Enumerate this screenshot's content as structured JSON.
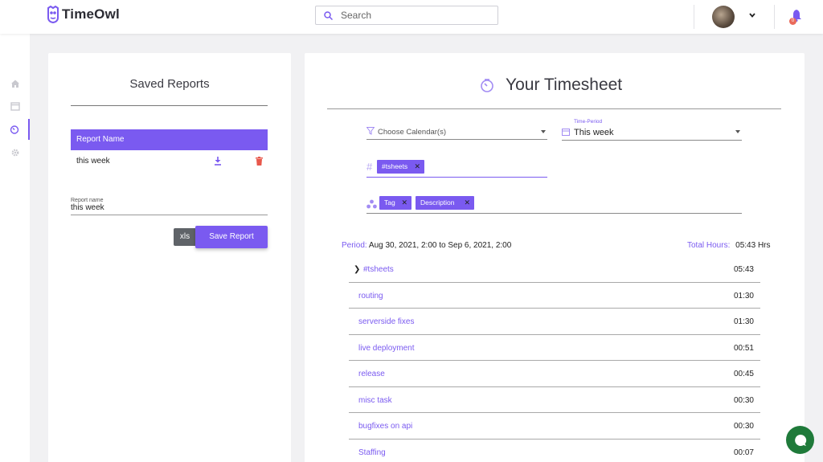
{
  "header": {
    "app_name": "TimeOwl",
    "search_placeholder": "Search",
    "notification_count": "0"
  },
  "sidebar": {
    "items": [
      {
        "icon": "home-icon"
      },
      {
        "icon": "calendar-icon"
      },
      {
        "icon": "timesheet-icon",
        "active": true
      },
      {
        "icon": "gear-icon"
      }
    ]
  },
  "saved_reports": {
    "title": "Saved Reports",
    "column_header": "Report Name",
    "reports": [
      {
        "name": "this week"
      }
    ],
    "report_name_label": "Report name",
    "report_name_value": "this week",
    "xls_label": "xls",
    "save_label": "Save Report"
  },
  "timesheet": {
    "title": "Your Timesheet",
    "calendar_placeholder": "Choose Calendar(s)",
    "time_period_label": "Time-Period",
    "time_period_value": "This week",
    "tag_chips": [
      "#tsheets"
    ],
    "group_chips": [
      "Tag",
      "Description"
    ],
    "period_label": "Period:",
    "period_value": "Aug 30, 2021, 2:00 to Sep 6, 2021, 2:00",
    "total_label": "Total Hours:",
    "total_value": "05:43 Hrs",
    "rows": [
      {
        "name": "#tsheets",
        "time": "05:43",
        "expandable": true
      },
      {
        "name": "routing",
        "time": "01:30"
      },
      {
        "name": "serverside fixes",
        "time": "01:30"
      },
      {
        "name": "live deployment",
        "time": "00:51"
      },
      {
        "name": "release",
        "time": "00:45"
      },
      {
        "name": "misc task",
        "time": "00:30"
      },
      {
        "name": "bugfixes on api",
        "time": "00:30"
      },
      {
        "name": "Staffing",
        "time": "00:07"
      }
    ]
  },
  "colors": {
    "accent": "#7a5af0",
    "delete": "#e8584b",
    "chat": "#1f7a3a"
  }
}
